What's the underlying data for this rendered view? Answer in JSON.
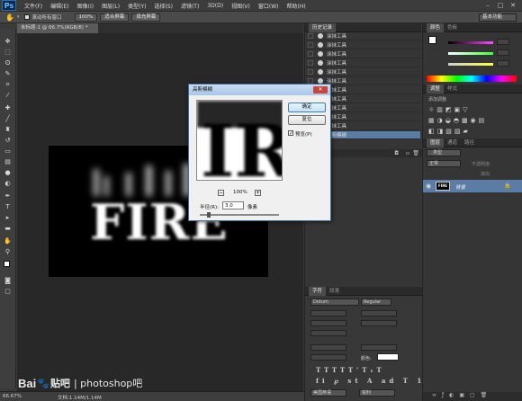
{
  "menubar": {
    "logo": "Ps",
    "items": [
      "文件(F)",
      "编辑(E)",
      "图像(I)",
      "图层(L)",
      "类型(Y)",
      "选择(S)",
      "滤镜(T)",
      "3D(D)",
      "视图(V)",
      "窗口(W)",
      "帮助(H)"
    ]
  },
  "options": {
    "scroll_all_label": "滚动所有窗口",
    "zoom_100": "100%",
    "fit_screen": "适合屏幕",
    "fill_screen": "填充屏幕",
    "workspace": "基本功能"
  },
  "document": {
    "tab_title": "未标题-1 @ 66.7%(RGB/8) *",
    "canvas_text": "FIRE",
    "status_zoom": "66.67%",
    "status_doc": "文档:1.14M/1.14M"
  },
  "history": {
    "title": "历史记录",
    "items": [
      "涂抹工具",
      "涂抹工具",
      "涂抹工具",
      "涂抹工具",
      "涂抹工具",
      "涂抹工具",
      "涂抹工具",
      "涂抹工具",
      "涂抹工具",
      "涂抹工具",
      "涂抹工具",
      "高斯模糊"
    ]
  },
  "dialog": {
    "title": "高斯模糊",
    "ok": "确定",
    "reset": "复位",
    "preview_label": "预览(P)",
    "zoom": "100%",
    "radius_label": "半径(R):",
    "radius_value": "3.0",
    "unit": "像素",
    "preview_text": "IR"
  },
  "color_panel": {
    "tab1": "颜色",
    "tab2": "色板"
  },
  "adjust_panel": {
    "tab1": "调整",
    "tab2": "样式",
    "add": "添加调整"
  },
  "layers": {
    "tab1": "图层",
    "tab2": "通道",
    "tab3": "路径",
    "filter": "类型",
    "blend": "正常",
    "opacity_label": "不透明度:",
    "fill_label": "填充:",
    "layer_name": "背景",
    "thumb_text": "FIRE"
  },
  "character": {
    "tab1": "字符",
    "tab2": "段落",
    "font": "Dotum",
    "style": "Regular",
    "color_label": "颜色:",
    "lang": "美国英语",
    "aa": "锐利"
  },
  "watermark": {
    "brand": "Bai",
    "brand2": "贴吧",
    "suffix": "| photoshop吧"
  },
  "colors": {
    "accent": "#5a7ca5",
    "canvas": "#000000",
    "dialog_bg": "#f0f0f0"
  }
}
